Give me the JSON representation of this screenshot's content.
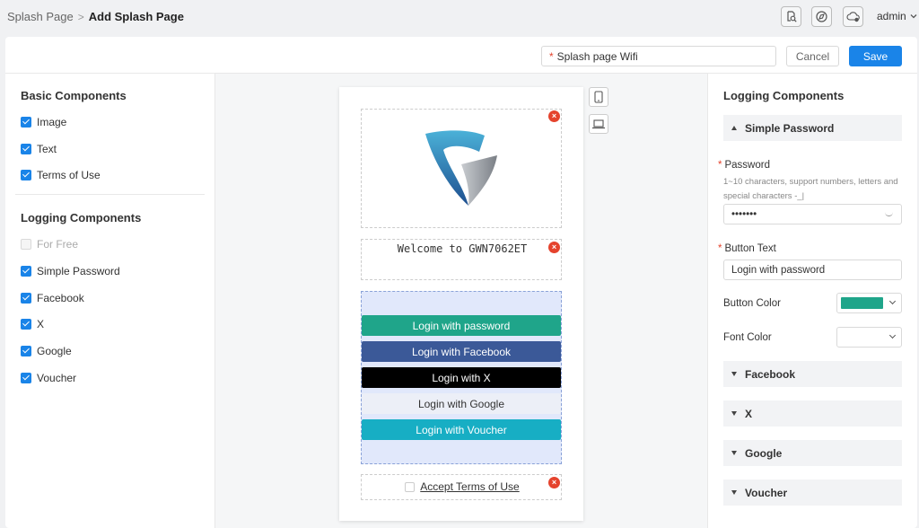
{
  "breadcrumb": {
    "parent": "Splash Page",
    "separator": ">",
    "current": "Add Splash Page"
  },
  "user": {
    "name": "admin"
  },
  "toolbar": {
    "name_value": "Splash page Wifi",
    "required_mark": "*",
    "cancel_label": "Cancel",
    "save_label": "Save"
  },
  "left": {
    "basic_title": "Basic Components",
    "basic_items": [
      {
        "label": "Image",
        "checked": true
      },
      {
        "label": "Text",
        "checked": true
      },
      {
        "label": "Terms of Use",
        "checked": true
      }
    ],
    "logging_title": "Logging Components",
    "logging_items": [
      {
        "label": "For Free",
        "checked": false,
        "disabled": true
      },
      {
        "label": "Simple Password",
        "checked": true
      },
      {
        "label": "Facebook",
        "checked": true
      },
      {
        "label": "X",
        "checked": true
      },
      {
        "label": "Google",
        "checked": true
      },
      {
        "label": "Voucher",
        "checked": true
      }
    ]
  },
  "preview": {
    "welcome_text": "Welcome to GWN7062ET",
    "delete_glyph": "×",
    "buttons": [
      {
        "label": "Login with password",
        "bg": "#1fa58a",
        "fg": "#ffffff"
      },
      {
        "label": "Login with Facebook",
        "bg": "#3b5998",
        "fg": "#ffffff"
      },
      {
        "label": "Login with X",
        "bg": "#000000",
        "fg": "#ffffff"
      },
      {
        "label": "Login with Google",
        "bg": "#eceff7",
        "fg": "#333333"
      },
      {
        "label": "Login with Voucher",
        "bg": "#17aec4",
        "fg": "#ffffff"
      }
    ],
    "terms_label": "Accept Terms of Use",
    "logo_colors": [
      "#1e5fa8",
      "#4bb1d8",
      "#8a8f96"
    ]
  },
  "right": {
    "title": "Logging Components",
    "simple_password": {
      "header": "Simple Password",
      "password_label": "Password",
      "password_hint": "1~10 characters, support numbers, letters and special characters -_|",
      "password_value": "•••••••",
      "button_text_label": "Button Text",
      "button_text_value": "Login with password",
      "button_color_label": "Button Color",
      "button_color": "#1fa58a",
      "font_color_label": "Font Color",
      "font_color": "#ffffff"
    },
    "collapsed": [
      "Facebook",
      "X",
      "Google",
      "Voucher"
    ]
  },
  "icons": [
    "search-doc-icon",
    "compass-icon",
    "cloud-settings-icon",
    "chevron-down-icon",
    "phone-icon",
    "laptop-icon",
    "eye-closed-icon",
    "close-icon"
  ],
  "accent": "#1a84e8"
}
